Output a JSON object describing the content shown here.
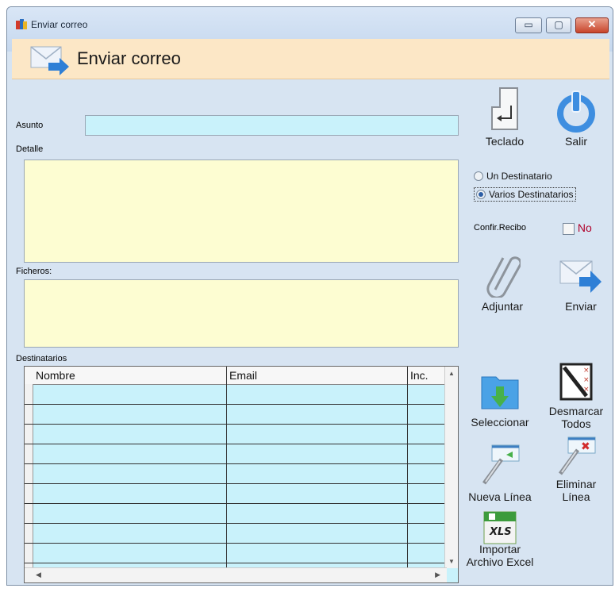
{
  "window": {
    "title": "Enviar correo",
    "minimize": "▭",
    "maximize": "▢",
    "close": "✕"
  },
  "header": {
    "title": "Enviar correo",
    "icon": "envelope-arrow-icon"
  },
  "form": {
    "asunto_label": "Asunto",
    "asunto_value": "",
    "detalle_label": "Detalle",
    "detalle_value": "",
    "ficheros_label": "Ficheros:",
    "ficheros_value": "",
    "destinatarios_label": "Destinatarios"
  },
  "tools": {
    "teclado": "Teclado",
    "salir": "Salir",
    "adjuntar": "Adjuntar",
    "enviar": "Enviar",
    "seleccionar": "Seleccionar",
    "desmarcar_1": "Desmarcar",
    "desmarcar_2": "Todos",
    "nueva_linea": "Nueva Línea",
    "eliminar_1": "Eliminar",
    "eliminar_2": "Línea",
    "importar_1": "Importar",
    "importar_2": "Archivo Excel",
    "xls_badge": "XLS"
  },
  "options": {
    "radio_un": "Un Destinatario",
    "radio_varios": "Varios Destinatarios",
    "selected": "Varios Destinatarios",
    "confir_label": "Confir.Recibo",
    "confir_value": "No",
    "confir_checked": false
  },
  "grid": {
    "columns": [
      "Nombre",
      "Email",
      "Inc."
    ],
    "rows": [
      [
        "",
        "",
        ""
      ],
      [
        "",
        "",
        ""
      ],
      [
        "",
        "",
        ""
      ],
      [
        "",
        "",
        ""
      ],
      [
        "",
        "",
        ""
      ],
      [
        "",
        "",
        ""
      ],
      [
        "",
        "",
        ""
      ],
      [
        "",
        "",
        ""
      ],
      [
        "",
        "",
        ""
      ]
    ]
  },
  "colors": {
    "input": "#c9f2fb",
    "textarea": "#fdfdd2",
    "header": "#fce7c6",
    "window": "#d7e4f2"
  }
}
